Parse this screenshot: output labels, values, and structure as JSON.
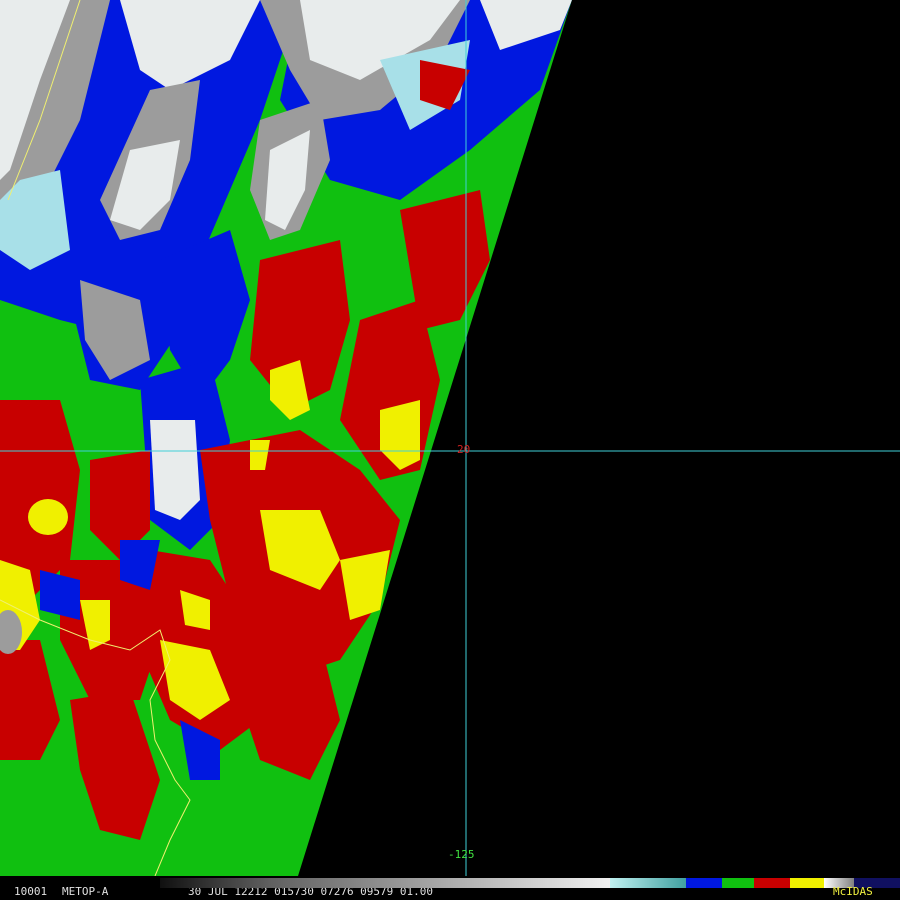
{
  "map": {
    "lat_label": "20",
    "lon_label": "-125"
  },
  "status_bar": {
    "frame_number": "10001",
    "satellite": "METOP-A",
    "image_info": "30 JUL 12212 015730 07276 09579 01.00",
    "brand": "McIDAS"
  },
  "colors": {
    "background": "#000000",
    "clear_gray": "#9c9c9c",
    "cold_cloud_white": "#e8ecec",
    "cyan": "#a8e0e8",
    "blue": "#0018e0",
    "green": "#10c010",
    "red": "#c80000",
    "yellow": "#f0f000",
    "grid_line": "#40d0d8",
    "lat_label_color": "#d02020",
    "lon_label_color": "#40e040",
    "coastline": "#f0f070"
  }
}
